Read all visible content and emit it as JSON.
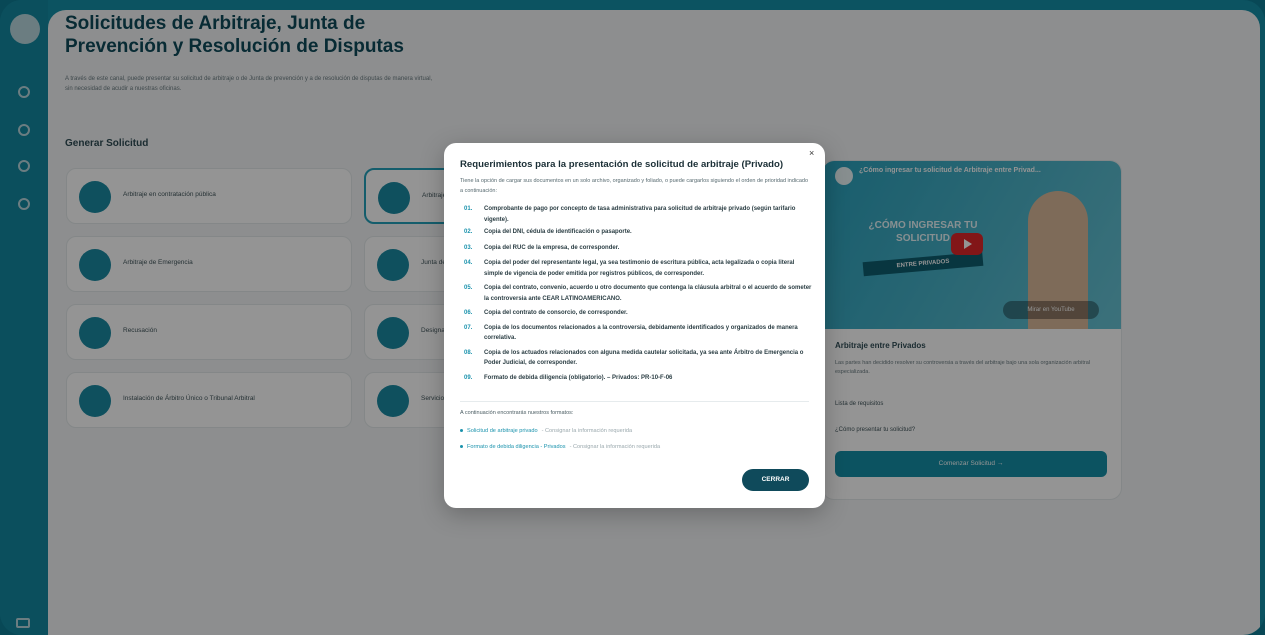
{
  "page": {
    "title": "Solicitudes de Arbitraje, Junta de Prevención y Resolución de Disputas",
    "description": "A través de este canal, puede presentar su solicitud de arbitraje o de Junta de prevención y a de resolución de disputas de manera virtual, sin necesidad de acudir a nuestras oficinas.",
    "section_title": "Generar Solicitud"
  },
  "cards": [
    {
      "label": "Arbitraje en contratación pública"
    },
    {
      "label": "Arbitraje entre Privados"
    },
    {
      "label": "Arbitraje de Emergencia"
    },
    {
      "label": "Junta de Prevención y Resolución de Disputas"
    },
    {
      "label": "Recusación"
    },
    {
      "label": "Designación de Árbitros"
    },
    {
      "label": "Instalación de Árbitro Único o Tribunal Arbitral"
    },
    {
      "label": "Servicio de Secretaría Arbitral"
    }
  ],
  "video_panel": {
    "video_title": "¿Cómo ingresar tu solicitud de Arbitraje entre Privad...",
    "headline": "¿CÓMO INGRESAR TU SOLICITUD",
    "banner": "ENTRE PRIVADOS",
    "youtube_label": "Mirar en YouTube",
    "title": "Arbitraje entre Privados",
    "description": "Las partes han decidido resolver su controversia a través del arbitraje bajo una sola organización arbitral especializada.",
    "items": [
      "Lista de requisitos",
      "¿Cómo presentar tu solicitud?"
    ],
    "button": "Comenzar Solicitud →"
  },
  "modal": {
    "close_symbol": "×",
    "title": "Requerimientos para la presentación de solicitud de arbitraje (Privado)",
    "intro": "Tiene la opción de cargar sus documentos en un solo archivo, organizado y foliado, o puede cargarlos siguiendo el orden de prioridad indicado a continuación:",
    "requirements": [
      {
        "num": "01.",
        "text": "Comprobante de pago por concepto de tasa administrativa para solicitud de arbitraje privado (según tarifario vigente)."
      },
      {
        "num": "02.",
        "text": "Copia del DNI, cédula de identificación o pasaporte."
      },
      {
        "num": "03.",
        "text": "Copia del RUC de la empresa, de corresponder."
      },
      {
        "num": "04.",
        "text": "Copia del poder del representante legal, ya sea testimonio de escritura pública, acta legalizada o copia literal simple de vigencia de poder emitida por registros públicos, de corresponder."
      },
      {
        "num": "05.",
        "text": "Copia del contrato, convenio, acuerdo u otro documento que contenga la cláusula arbitral o el acuerdo de someter la controversia ante CEAR LATINOAMERICANO."
      },
      {
        "num": "06.",
        "text": "Copia del contrato de consorcio, de corresponder."
      },
      {
        "num": "07.",
        "text": "Copia de los documentos relacionados a la controversia, debidamente identificados y organizados de manera correlativa."
      },
      {
        "num": "08.",
        "text": "Copia de los actuados relacionados con alguna medida cautelar solicitada, ya sea ante Árbitro de Emergencia o Poder Judicial, de corresponder."
      },
      {
        "num": "09.",
        "text": "Formato de debida diligencia (obligatorio). – Privados: PR-10-F-06"
      }
    ],
    "formats_intro": "A continuación encontrarás nuestros formatos:",
    "formats": [
      {
        "link": "Solicitud de arbitraje privado",
        "hint": "- Consignar la información requerida"
      },
      {
        "link": "Formato de debida diligencia - Privados",
        "hint": "- Consignar la información requerida"
      }
    ],
    "button": "CERRAR"
  }
}
